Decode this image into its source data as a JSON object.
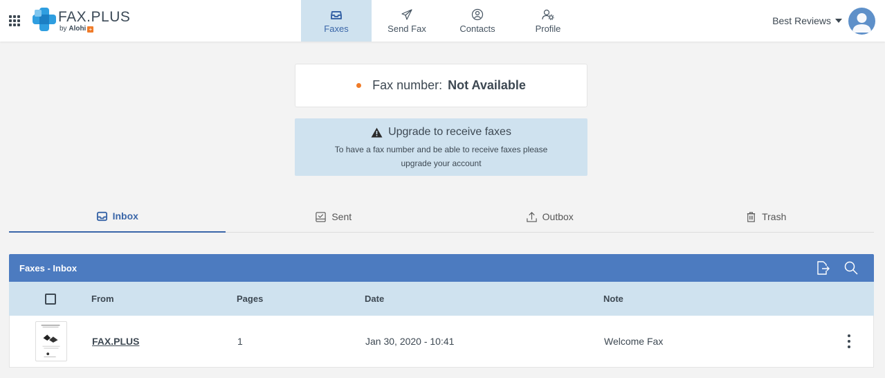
{
  "app": {
    "logo_text": "FAX.PLUS",
    "logo_by": "by",
    "logo_brand": "Alohi",
    "logo_plus": "+"
  },
  "nav": {
    "items": [
      {
        "label": "Faxes",
        "icon": "inbox-tray-icon",
        "active": true
      },
      {
        "label": "Send Fax",
        "icon": "paper-plane-icon",
        "active": false
      },
      {
        "label": "Contacts",
        "icon": "user-circle-icon",
        "active": false
      },
      {
        "label": "Profile",
        "icon": "user-gear-icon",
        "active": false
      }
    ]
  },
  "user": {
    "name": "Best Reviews",
    "avatar_color": "#5e90c9"
  },
  "fax_number": {
    "label": "Fax number:",
    "value": "Not Available",
    "status_color": "#f07b28"
  },
  "upgrade": {
    "title": "Upgrade to receive faxes",
    "text": "To have a fax number and be able to receive faxes please upgrade your account"
  },
  "tabs": [
    {
      "label": "Inbox",
      "icon": "inbox-tray-icon",
      "active": true
    },
    {
      "label": "Sent",
      "icon": "sent-check-icon",
      "active": false
    },
    {
      "label": "Outbox",
      "icon": "upload-tray-icon",
      "active": false
    },
    {
      "label": "Trash",
      "icon": "trash-icon",
      "active": false
    }
  ],
  "table": {
    "title": "Faxes - Inbox",
    "columns": {
      "from": "From",
      "pages": "Pages",
      "date": "Date",
      "note": "Note"
    },
    "rows": [
      {
        "from": "FAX.PLUS",
        "pages": "1",
        "date": "Jan 30, 2020 - 10:41",
        "note": "Welcome Fax"
      }
    ]
  },
  "colors": {
    "accent": "#4c7bc0",
    "nav_active_bg": "#cfe2ef",
    "active_text": "#3a66a8"
  }
}
